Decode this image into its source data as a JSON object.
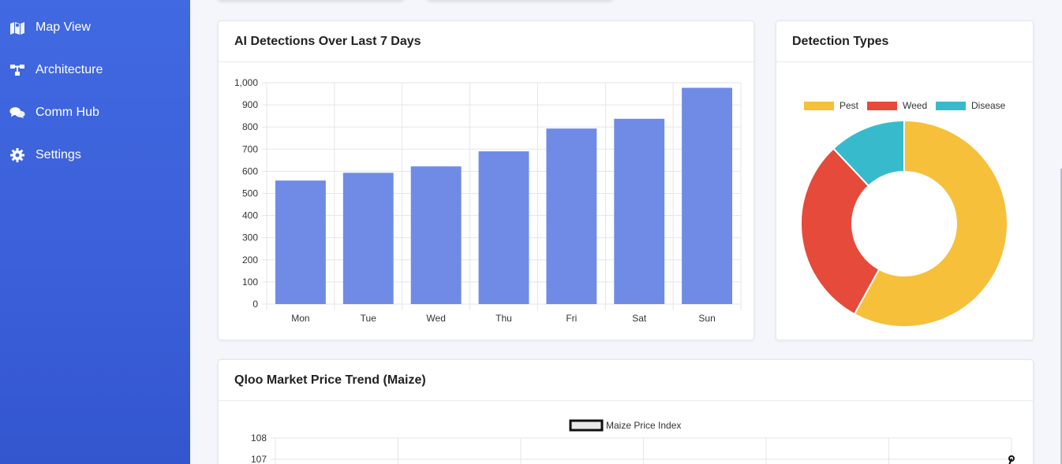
{
  "sidebar": {
    "items": [
      {
        "label": "Map View",
        "icon": "map-icon"
      },
      {
        "label": "Architecture",
        "icon": "sitemap-icon"
      },
      {
        "label": "Comm Hub",
        "icon": "chat-bubbles-icon"
      },
      {
        "label": "Settings",
        "icon": "gear-icon"
      }
    ]
  },
  "cards": {
    "detections": {
      "title": "AI Detections Over Last 7 Days"
    },
    "types": {
      "title": "Detection Types"
    },
    "market": {
      "title": "Qloo Market Price Trend (Maize)"
    }
  },
  "colors": {
    "sidebar_top": "#4169e1",
    "bar": "#6f8be6",
    "pest": "#f6c03b",
    "weed": "#e64a3b",
    "disease": "#38bacd"
  },
  "chart_data": [
    {
      "type": "bar",
      "categories": [
        "Mon",
        "Tue",
        "Wed",
        "Thu",
        "Fri",
        "Sat",
        "Sun"
      ],
      "values": [
        558,
        593,
        622,
        690,
        793,
        837,
        977
      ],
      "ylim": [
        0,
        1000
      ],
      "yticks": [
        "0",
        "100",
        "200",
        "300",
        "400",
        "500",
        "600",
        "700",
        "800",
        "900",
        "1,000"
      ],
      "grid": true,
      "legend": "none"
    },
    {
      "type": "pie",
      "variant": "doughnut",
      "labels": [
        "Pest",
        "Weed",
        "Disease"
      ],
      "values": [
        58,
        30,
        12
      ],
      "legend": "top"
    },
    {
      "type": "line",
      "series": [
        {
          "name": "Maize Price Index",
          "values": []
        }
      ],
      "yticks": [
        "108",
        "107"
      ],
      "grid": true,
      "legend": "top"
    }
  ]
}
